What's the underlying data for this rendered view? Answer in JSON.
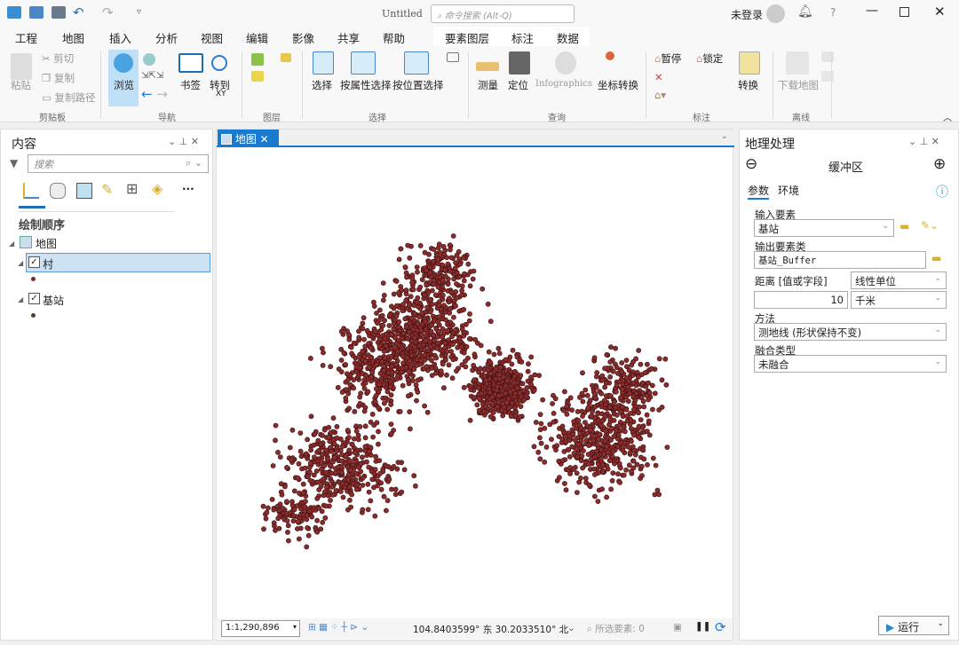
{
  "titlebar": {
    "title": "Untitled",
    "search_placeholder": "命令搜索 (Alt-Q)",
    "user": "未登录",
    "help": "?"
  },
  "tabs": [
    "工程",
    "地图",
    "插入",
    "分析",
    "视图",
    "编辑",
    "影像",
    "共享",
    "帮助"
  ],
  "active_tab": "地图",
  "context_tabs": [
    "要素图层",
    "标注",
    "数据"
  ],
  "ribbon": {
    "clipboard": {
      "paste": "粘贴",
      "cut": "剪切",
      "copy": "复制",
      "copy_path": "复制路径",
      "group": "剪贴板"
    },
    "navigate": {
      "explore": "浏览",
      "bookmarks": "书签",
      "goto": "转到",
      "goto_sub": "XY",
      "group": "导航"
    },
    "layer": {
      "group": "图层"
    },
    "selection": {
      "select": "选择",
      "by_attr": "按属性选择",
      "by_loc": "按位置选择",
      "group": "选择"
    },
    "inquiry": {
      "measure": "测量",
      "locate": "定位",
      "infographics": "Infographics",
      "convert_coords": "坐标转换",
      "group": "查询"
    },
    "labeling": {
      "pause": "暂停",
      "lock": "锁定",
      "convert": "转换",
      "group": "标注"
    },
    "offline": {
      "download": "下载地图",
      "group": "离线"
    }
  },
  "contents": {
    "title": "内容",
    "search_placeholder": "搜索",
    "section": "绘制顺序",
    "map": "地图",
    "layers": [
      {
        "name": "村",
        "symbol_color": "#7a2a2a",
        "checked": true,
        "selected": true
      },
      {
        "name": "基站",
        "symbol_color": "#5a3a2a",
        "checked": true,
        "selected": false
      }
    ]
  },
  "map_tab": {
    "label": "地图"
  },
  "map": {
    "point_fill": "#8b2c2c",
    "point_stroke": "#3a1010"
  },
  "status": {
    "scale": "1:1,290,896",
    "coords": "104.8403599° 东 30.2033510° 北",
    "selected_label": "所选要素: 0"
  },
  "geoprocessing": {
    "title": "地理处理",
    "tool": "缓冲区",
    "tabs": [
      "参数",
      "环境"
    ],
    "input_label": "输入要素",
    "input_value": "基站",
    "output_label": "输出要素类",
    "output_value": "基站_Buffer",
    "distance_label": "距离 [值或字段]",
    "distance_type": "线性单位",
    "distance_value": "10",
    "distance_unit": "千米",
    "method_label": "方法",
    "method_value": "测地线 (形状保持不变)",
    "dissolve_label": "融合类型",
    "dissolve_value": "未融合",
    "run": "运行"
  }
}
